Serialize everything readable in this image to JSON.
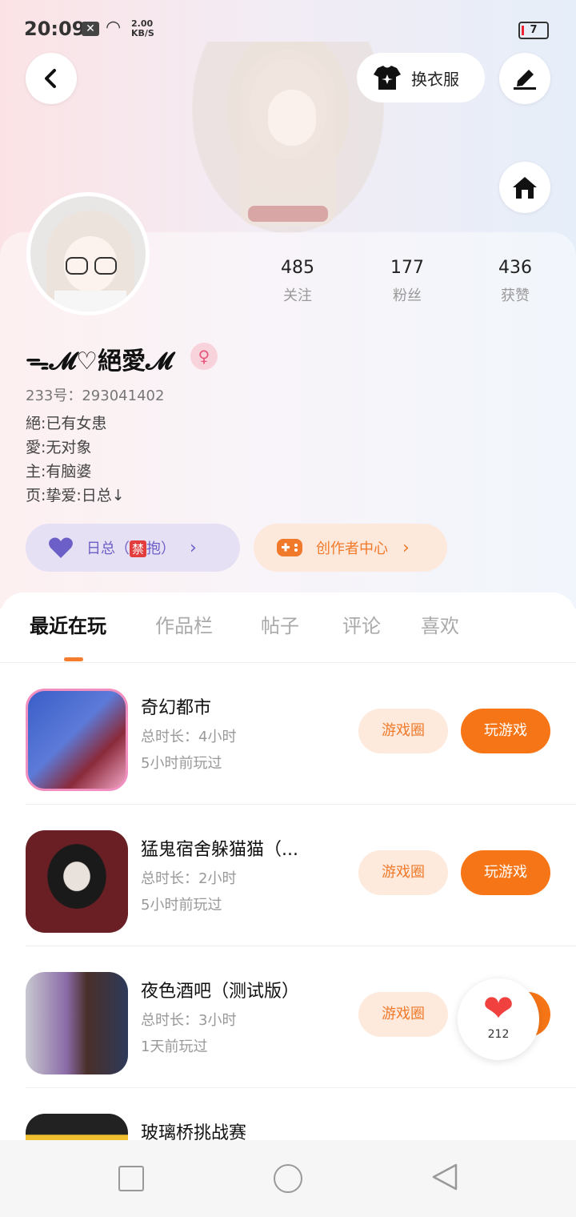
{
  "status_bar": {
    "time": "20:09",
    "speed_value": "2.00",
    "speed_unit": "KB/S",
    "battery": "7"
  },
  "header": {
    "outfit_label": "换衣服"
  },
  "profile": {
    "stats": [
      {
        "value": "485",
        "label": "关注"
      },
      {
        "value": "177",
        "label": "粉丝"
      },
      {
        "value": "436",
        "label": "获赞"
      }
    ],
    "nickname": "ᯓ𝓜♡絕愛𝓜",
    "gender_symbol": "♀",
    "uid": "233号：293041402",
    "bio": "絕:已有女患\n愛:无对象\n主:有脑婆\n页:挚爱:日总↓",
    "status_pill": {
      "prefix": "日总（",
      "badge": "禁",
      "suffix": "抱）"
    },
    "creator_pill": "创作者中心"
  },
  "tabs": [
    "最近在玩",
    "作品栏",
    "帖子",
    "评论",
    "喜欢"
  ],
  "games": [
    {
      "title": "奇幻都市",
      "duration": "总时长：4小时",
      "last_played": "5小时前玩过",
      "circle_label": "游戏圈",
      "play_label": "玩游戏"
    },
    {
      "title": "猛鬼宿舍躲猫猫（...",
      "duration": "总时长：2小时",
      "last_played": "5小时前玩过",
      "circle_label": "游戏圈",
      "play_label": "玩游戏"
    },
    {
      "title": "夜色酒吧（测试版）",
      "duration": "总时长：3小时",
      "last_played": "1天前玩过",
      "circle_label": "游戏圈",
      "play_label": "玩游戏"
    },
    {
      "title": "玻璃桥挑战赛"
    }
  ],
  "floating_like": {
    "count": "212"
  },
  "colors": {
    "accent": "#f67517",
    "status_pill": "#6c5fc7",
    "heart": "#f0413f"
  }
}
